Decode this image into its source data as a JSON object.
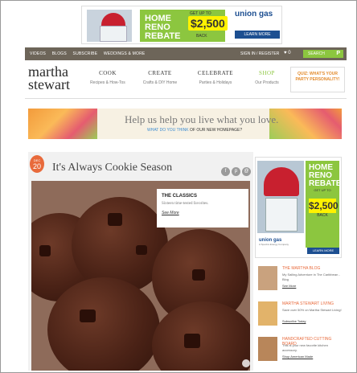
{
  "top_ad": {
    "headline": "HOME RENO REBATE",
    "offer_prefix": "GET UP TO",
    "amount": "$2,500",
    "offer_suffix": "BACK",
    "sponsor": "union gas",
    "cta": "LEARN MORE"
  },
  "top_nav": {
    "links": [
      "VIDEOS",
      "BLOGS",
      "SUBSCRIBE",
      "WEDDINGS & MORE"
    ],
    "signin": "SIGN IN / REGISTER",
    "heart_count": "0",
    "search_label": "SEARCH",
    "search_icon": "P"
  },
  "header": {
    "logo_line1": "martha",
    "logo_line2": "stewart",
    "nav": [
      {
        "title": "COOK",
        "sub": "Recipes & How-Tos"
      },
      {
        "title": "CREATE",
        "sub": "Crafts & DIY Home"
      },
      {
        "title": "CELEBRATE",
        "sub": "Parties & Holidays"
      },
      {
        "title": "SHOP",
        "sub": "Our Products"
      }
    ],
    "quiz": "QUIZ: WHAT'S YOUR PARTY PERSONALITY!"
  },
  "banner": {
    "headline": "Help us help you live what you love.",
    "link_text": "WHAT DO YOU THINK",
    "rest_text": "OF OUR NEW HOMEPAGE?"
  },
  "article": {
    "date_month": "DEC",
    "date_day": "20",
    "title": "It's Always Cookie Season",
    "caption_title": "THE CLASSICS",
    "caption_desc": "Sixteen time-tested favorites.",
    "caption_link": "See More"
  },
  "side_ad": {
    "headline": "HOME RENO REBATE",
    "offer_prefix": "GET UP TO",
    "amount": "$2,500",
    "offer_suffix": "BACK",
    "sponsor": "union gas",
    "sponsor_sub": "A Spectra Energy Company",
    "cta": "LEARN MORE"
  },
  "promos": [
    {
      "title": "THE MARTHA BLOG",
      "desc": "My Sailing Adventure in The Caribbean - Blog",
      "link": "See More"
    },
    {
      "title": "MARTHA STEWART LIVING",
      "desc": "Save over 50% on Martha Stewart Living!",
      "link": "Subscribe Today"
    },
    {
      "title": "HANDCRAFTED CUTTING BOARD",
      "desc": "This is your new favorite kitchen accessory.",
      "link": "Shop American Made"
    }
  ],
  "colors": {
    "brand_green": "#8cc63f",
    "accent_orange": "#e86a3b",
    "nav_brown": "#6d6559",
    "sponsor_blue": "#1d4f91"
  }
}
